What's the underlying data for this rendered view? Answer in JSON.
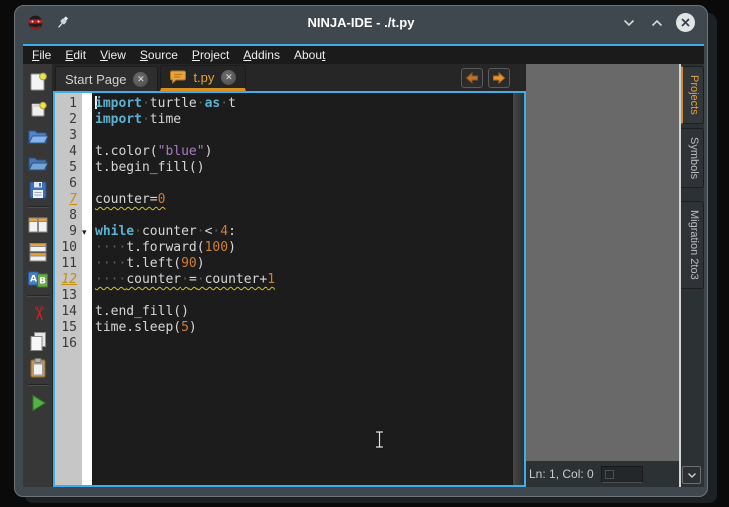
{
  "window": {
    "title": "NINJA-IDE - ./t.py",
    "controls": {
      "minimize": "minimize",
      "maximize": "maximize",
      "close": "close"
    }
  },
  "menu": {
    "items": [
      {
        "label": "File",
        "u": 0
      },
      {
        "label": "Edit",
        "u": 0
      },
      {
        "label": "View",
        "u": 0
      },
      {
        "label": "Source",
        "u": 0
      },
      {
        "label": "Project",
        "u": 0
      },
      {
        "label": "Addins",
        "u": 0
      },
      {
        "label": "About",
        "u": 4
      }
    ]
  },
  "tabs": {
    "items": [
      {
        "label": "Start Page",
        "active": false,
        "icon": null
      },
      {
        "label": "t.py",
        "active": true,
        "icon": "comment-bubble-icon"
      }
    ]
  },
  "toolbar": {
    "items": [
      "new-file",
      "new-project",
      "open-file",
      "open-project",
      "save",
      "split-horizontal",
      "split-vertical",
      "follow-mode",
      "cut",
      "copy",
      "paste",
      "run"
    ]
  },
  "editor": {
    "lines": [
      {
        "num": 1,
        "caret": true,
        "segs": [
          [
            "k",
            "import"
          ],
          [
            "w",
            "·"
          ],
          [
            "t",
            "turtle"
          ],
          [
            "w",
            "·"
          ],
          [
            "k",
            "as"
          ],
          [
            "w",
            "·"
          ],
          [
            "t",
            "t"
          ]
        ]
      },
      {
        "num": 2,
        "segs": [
          [
            "k",
            "import"
          ],
          [
            "w",
            "·"
          ],
          [
            "t",
            "time"
          ]
        ]
      },
      {
        "num": 3,
        "segs": []
      },
      {
        "num": 4,
        "segs": [
          [
            "t",
            "t.color("
          ],
          [
            "s",
            "\"blue\""
          ],
          [
            "t",
            ")"
          ]
        ]
      },
      {
        "num": 5,
        "segs": [
          [
            "t",
            "t.begin_fill()"
          ]
        ]
      },
      {
        "num": 6,
        "segs": []
      },
      {
        "num": 7,
        "warn": true,
        "segs": [
          [
            "t",
            "counter="
          ],
          [
            "d",
            "0"
          ]
        ]
      },
      {
        "num": 8,
        "segs": []
      },
      {
        "num": 9,
        "fold": true,
        "segs": [
          [
            "k",
            "while"
          ],
          [
            "w",
            "·"
          ],
          [
            "t",
            "counter"
          ],
          [
            "w",
            "·"
          ],
          [
            "t",
            "<"
          ],
          [
            "w",
            "·"
          ],
          [
            "d",
            "4"
          ],
          [
            "t",
            ":"
          ]
        ]
      },
      {
        "num": 10,
        "segs": [
          [
            "w",
            "····"
          ],
          [
            "t",
            "t.forward("
          ],
          [
            "d",
            "100"
          ],
          [
            "t",
            ")"
          ]
        ]
      },
      {
        "num": 11,
        "segs": [
          [
            "w",
            "····"
          ],
          [
            "t",
            "t.left("
          ],
          [
            "d",
            "90"
          ],
          [
            "t",
            ")"
          ]
        ]
      },
      {
        "num": 12,
        "warn": true,
        "segs": [
          [
            "w",
            "····"
          ],
          [
            "t",
            "counter"
          ],
          [
            "w",
            "·"
          ],
          [
            "t",
            "="
          ],
          [
            "w",
            "·"
          ],
          [
            "t",
            "counter+"
          ],
          [
            "d",
            "1"
          ]
        ]
      },
      {
        "num": 13,
        "segs": []
      },
      {
        "num": 14,
        "segs": [
          [
            "t",
            "t.end_fill()"
          ]
        ]
      },
      {
        "num": 15,
        "segs": [
          [
            "t",
            "time.sleep("
          ],
          [
            "d",
            "5"
          ],
          [
            "t",
            ")"
          ]
        ]
      },
      {
        "num": 16,
        "segs": []
      }
    ]
  },
  "right_panel": {
    "tabs": [
      {
        "label": "Projects",
        "active": true
      },
      {
        "label": "Symbols",
        "active": false
      },
      {
        "label": "Migration 2to3",
        "active": false
      }
    ]
  },
  "status": {
    "line_col": "Ln: 1, Col: 0"
  },
  "colors": {
    "accent_orange": "#db8f1f",
    "accent_cyan": "#3daee9",
    "keyword": "#58b2d0",
    "number": "#cf7d34",
    "string": "#a97cc0",
    "warning": "#d4c428",
    "gutter": "#c6c6c6",
    "editor_bg": "#1c1c1c",
    "titlebar_bg": "#3e484e",
    "panel_bg": "#696969"
  }
}
